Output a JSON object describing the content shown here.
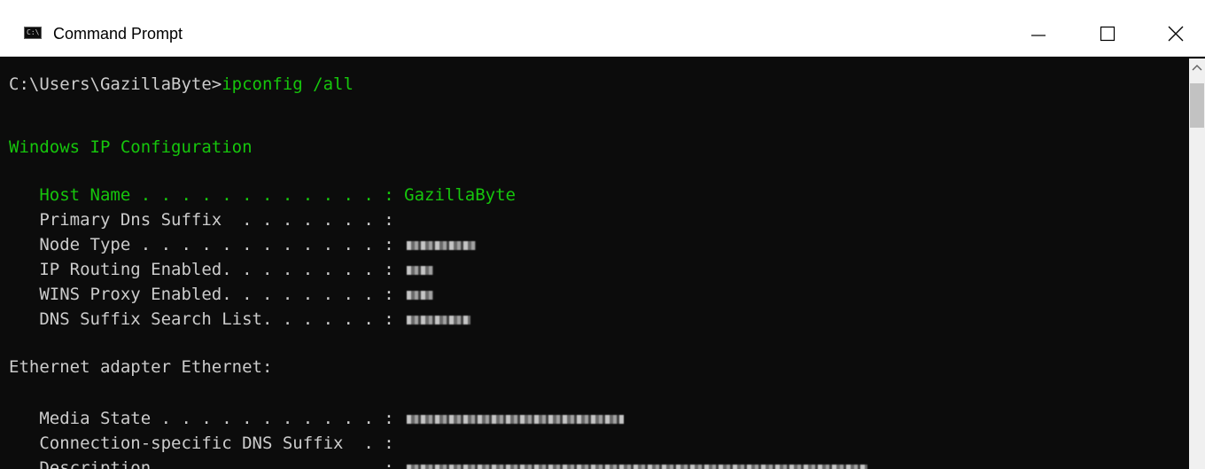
{
  "window": {
    "title": "Command Prompt",
    "icon": "cmd-icon",
    "controls": {
      "minimize": "minimize-icon",
      "maximize": "maximize-icon",
      "close": "close-icon"
    }
  },
  "console": {
    "prompt": "C:\\Users\\GazillaByte>",
    "command": "ipconfig /all",
    "section1": "Windows IP Configuration",
    "host_name_label": "   Host Name . . . . . . . . . . . . : ",
    "host_name_value": "GazillaByte",
    "primary_dns_label": "   Primary Dns Suffix  . . . . . . . :",
    "node_type_label": "   Node Type . . . . . . . . . . . . :",
    "ip_routing_label": "   IP Routing Enabled. . . . . . . . :",
    "wins_proxy_label": "   WINS Proxy Enabled. . . . . . . . :",
    "dns_search_label": "   DNS Suffix Search List. . . . . . :",
    "section2": "Ethernet adapter Ethernet:",
    "media_state_label": "   Media State . . . . . . . . . . . :",
    "conn_dns_label": "   Connection-specific DNS Suffix  . :",
    "description_label": "   Description . . . . . . . . . . . :"
  },
  "colors": {
    "console_bg": "#0c0c0c",
    "console_text": "#cccccc",
    "highlight_text": "#16c60c"
  }
}
